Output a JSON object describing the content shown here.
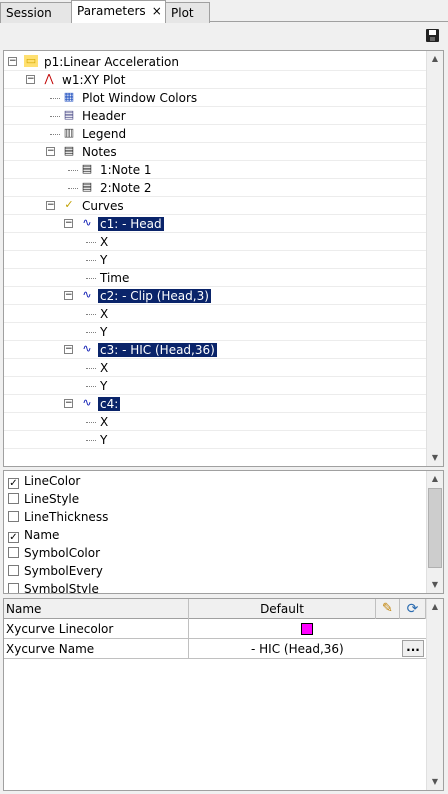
{
  "tabs": [
    {
      "label": "Session",
      "active": false
    },
    {
      "label": "Parameters",
      "active": true,
      "close": "×"
    },
    {
      "label": "Plot",
      "active": false
    }
  ],
  "toolbar": {
    "save_icon": "save-icon"
  },
  "tree": {
    "items": [
      {
        "label": "p1:Linear Acceleration",
        "icon": "folder-icon",
        "expander": "−"
      },
      {
        "label": "w1:XY Plot",
        "icon": "xy-plot-icon",
        "expander": "−"
      },
      {
        "label": "Plot Window Colors",
        "icon": "colors-icon"
      },
      {
        "label": "Header",
        "icon": "header-icon"
      },
      {
        "label": "Legend",
        "icon": "legend-icon"
      },
      {
        "label": "Notes",
        "icon": "notes-icon",
        "expander": "−"
      },
      {
        "label": "1:Note 1",
        "icon": "note-icon"
      },
      {
        "label": "2:Note 2",
        "icon": "note-icon"
      },
      {
        "label": "Curves",
        "icon": "curves-icon",
        "expander": "−"
      },
      {
        "label": "c1: - Head",
        "icon": "curve-icon",
        "expander": "−",
        "selected": true
      },
      {
        "label": "X"
      },
      {
        "label": "Y"
      },
      {
        "label": "Time"
      },
      {
        "label": "c2: - Clip (Head,3)",
        "icon": "curve-icon",
        "expander": "−",
        "selected": true
      },
      {
        "label": "X"
      },
      {
        "label": "Y"
      },
      {
        "label": "c3: - HIC (Head,36)",
        "icon": "curve-icon",
        "expander": "−",
        "selected": true
      },
      {
        "label": "X"
      },
      {
        "label": "Y"
      },
      {
        "label": "c4:",
        "icon": "curve-icon",
        "expander": "−",
        "selected": true
      },
      {
        "label": "X"
      },
      {
        "label": "Y"
      }
    ]
  },
  "properties": [
    {
      "label": "LineColor",
      "checked": true
    },
    {
      "label": "LineStyle",
      "checked": false
    },
    {
      "label": "LineThickness",
      "checked": false
    },
    {
      "label": "Name",
      "checked": true
    },
    {
      "label": "SymbolColor",
      "checked": false
    },
    {
      "label": "SymbolEvery",
      "checked": false
    },
    {
      "label": "SymbolStyle",
      "checked": false
    }
  ],
  "grid": {
    "headers": {
      "name": "Name",
      "default": "Default"
    },
    "rows": [
      {
        "name": "Xycurve Linecolor",
        "value": "",
        "swatch": "#ff00ff"
      },
      {
        "name": "Xycurve Name",
        "value": "- HIC (Head,36)",
        "button": "..."
      }
    ]
  },
  "colors": {
    "selection": "#0a246a",
    "swatch": "#ff00ff"
  }
}
